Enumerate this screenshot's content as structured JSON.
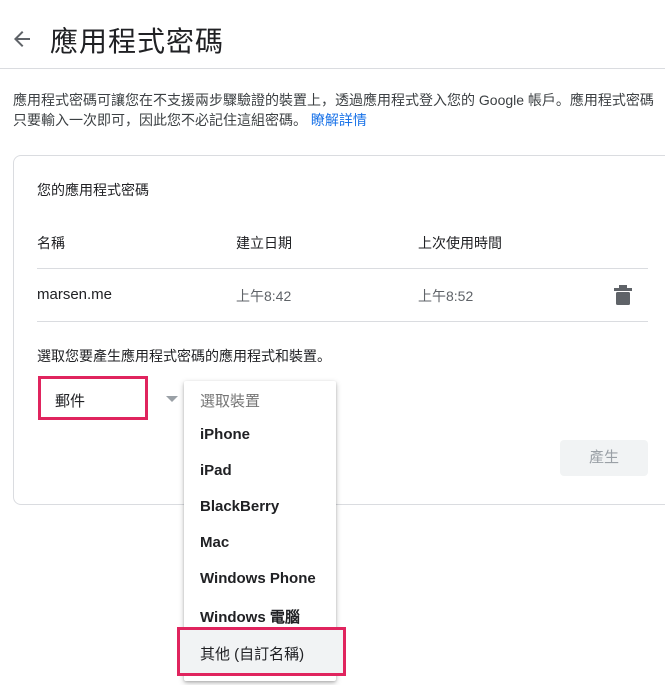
{
  "header": {
    "title": "應用程式密碼",
    "back_icon": "arrow-back-icon"
  },
  "description": {
    "line1": "應用程式密碼可讓您在不支援兩步驟驗證的裝置上，透過應用程式登入您的 Google 帳戶。應用程式密碼",
    "line2": "只要輸入一次即可，因此您不必記住這組密碼。",
    "learn_more": "瞭解詳情"
  },
  "passwords": {
    "heading": "您的應用程式密碼",
    "columns": {
      "name": "名稱",
      "created": "建立日期",
      "last_used": "上次使用時間"
    },
    "rows": [
      {
        "name": "marsen.me",
        "created": "上午8:42",
        "last_used": "上午8:52",
        "delete_icon": "trash-icon"
      }
    ]
  },
  "generate": {
    "prompt": "選取您要產生應用程式密碼的應用程式和裝置。",
    "app_value": "郵件",
    "button_label": "產生",
    "device_menu": {
      "placeholder": "選取裝置",
      "options": [
        "iPhone",
        "iPad",
        "BlackBerry",
        "Mac",
        "Windows Phone",
        "Windows 電腦",
        "其他 (自訂名稱)"
      ]
    }
  },
  "colors": {
    "accent": "#1a73e8",
    "highlight": "#e0245e",
    "divider": "#dadce0"
  }
}
